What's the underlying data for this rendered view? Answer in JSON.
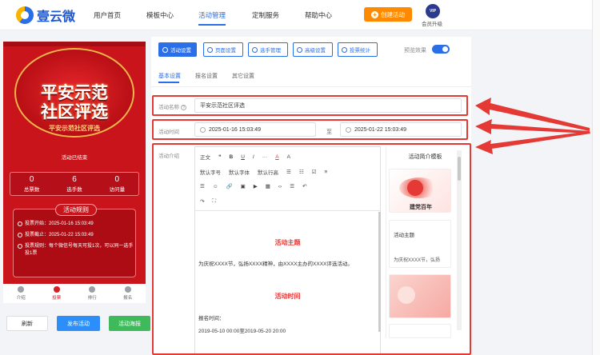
{
  "app": {
    "logo_text": "壹云微"
  },
  "nav": {
    "items": [
      {
        "label": "用户首页"
      },
      {
        "label": "模板中心"
      },
      {
        "label": "活动管理"
      },
      {
        "label": "定制服务"
      },
      {
        "label": "帮助中心"
      }
    ],
    "active": "活动管理",
    "create_button": "创建活动",
    "vip_badge": "VIP",
    "vip_label": "会员升级"
  },
  "preview": {
    "banner_title_line1": "平安示范",
    "banner_title_line2": "社区评选",
    "activity_title": "平安示范社区评选",
    "status": "活动已结束",
    "stats": [
      {
        "value": "0",
        "label": "总票数"
      },
      {
        "value": "6",
        "label": "选手数"
      },
      {
        "value": "0",
        "label": "访问量"
      }
    ],
    "rules_heading": "活动规则",
    "rules": [
      "投票开始：2025-01-16 15:03:49",
      "投票截止：2025-01-22 15:03:49",
      "投票规则：每个微信号每天可投1次，可以同一选手投1票"
    ],
    "tabbar": [
      {
        "label": "介绍"
      },
      {
        "label": "投票"
      },
      {
        "label": "排行"
      },
      {
        "label": "报名"
      }
    ],
    "active_tab": "投票",
    "buttons": {
      "refresh": "刷新",
      "publish": "发布活动",
      "poster": "活动海报"
    }
  },
  "toolbar": {
    "buttons": [
      {
        "label": "活动设置"
      },
      {
        "label": "页面设置"
      },
      {
        "label": "选手管理"
      },
      {
        "label": "高级设置"
      },
      {
        "label": "投票统计"
      }
    ],
    "preview_label": "预览效果",
    "preview_on": true
  },
  "subtabs": [
    {
      "label": "基本设置"
    },
    {
      "label": "报名设置"
    },
    {
      "label": "其它设置"
    }
  ],
  "form": {
    "name_label": "活动名称",
    "name_value": "平安示范社区评选",
    "time_label": "活动时间",
    "time_start": "2025-01-16 15:03:49",
    "time_to": "至",
    "time_end": "2025-01-22 15:03:49",
    "intro_label": "活动介绍"
  },
  "editor": {
    "toolbar_row1": [
      "正文",
      "❝",
      "B",
      "U",
      "I",
      "···",
      "A",
      "A"
    ],
    "toolbar_row2": [
      "默认字号",
      "默认字体",
      "默认行高",
      "☰",
      "☷",
      "☑",
      "≡"
    ],
    "toolbar_row3": [
      "☰",
      "☺",
      "🔗",
      "▣",
      "▶",
      "▦",
      "‹›",
      "☰",
      "↶"
    ],
    "toolbar_row4": [
      "↷",
      "⛶"
    ],
    "content_heading1": "活动主题",
    "content_para1": "为庆祝XXXX节，弘扬XXXX精神，由XXXX主办的XXXX评选活动。",
    "content_heading2": "活动时间",
    "content_para2": "报名时间：",
    "content_para3": "2019-05-10 00:00至2019-05-20 20:00"
  },
  "templates": {
    "title": "活动简介模板",
    "card1_caption": "建党百年",
    "card2_title": "活动主题",
    "card2_body": "为庆祝XXXX节，弘扬"
  },
  "colors": {
    "accent": "#2a6ee8",
    "highlight": "#e53935",
    "brand_red": "#c8141a"
  }
}
